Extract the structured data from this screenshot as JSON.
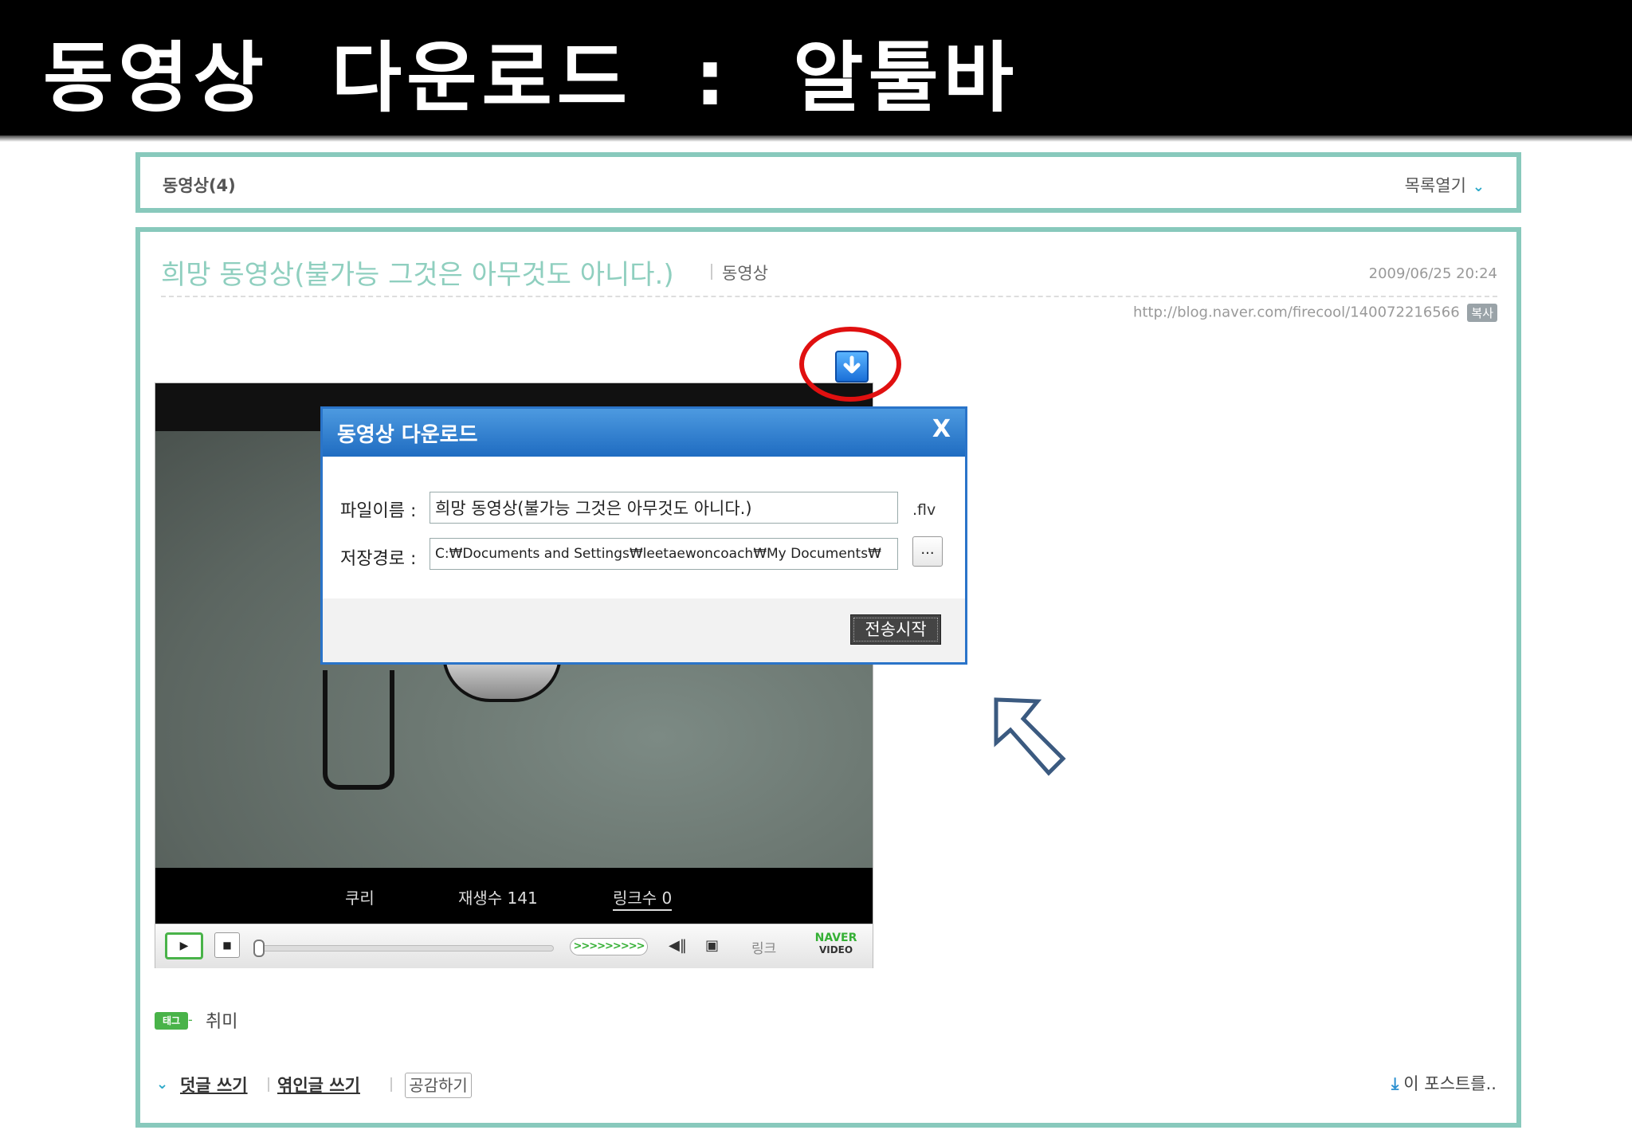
{
  "slide_title": "동영상  다운로드  :  알툴바",
  "category": {
    "label": "동영상(4)",
    "toggle_label": "목록열기"
  },
  "post": {
    "title": "희망 동영상(불가능 그것은 아무것도 아니다.)",
    "category": "동영상",
    "date": "2009/06/25 20:24",
    "url": "http://blog.naver.com/firecool/140072216566",
    "copy_label": "복사"
  },
  "player": {
    "stats": {
      "tag": "쿠리",
      "plays": "재생수 141",
      "links": "링크수 0"
    },
    "controls": {
      "speed": ">>>>>>>>>",
      "link_label": "링크",
      "brand_top": "NAVER",
      "brand_bottom": "VIDEO"
    }
  },
  "dialog": {
    "title": "동영상 다운로드",
    "close": "X",
    "filename_label": "파일이름 :",
    "filename_value": "희망 동영상(불가능 그것은 아무것도 아니다.)",
    "ext": ".flv",
    "path_label": "저장경로 :",
    "path_value": "C:₩Documents and Settings₩leetaewoncoach₩My Documents₩",
    "browse": "...",
    "start_button": "전송시작"
  },
  "tags": {
    "badge": "태그",
    "value": "취미"
  },
  "actions": {
    "comment": "덧글 쓰기",
    "trackback": "엮인글 쓰기",
    "like": "공감하기",
    "this_post": "이 포스트를.."
  },
  "colors": {
    "frame": "#88c9bc",
    "title_text": "#8fcfbf",
    "dialog_blue": "#2a74c9",
    "highlight_red": "#e01010",
    "naver_green": "#35b035"
  }
}
